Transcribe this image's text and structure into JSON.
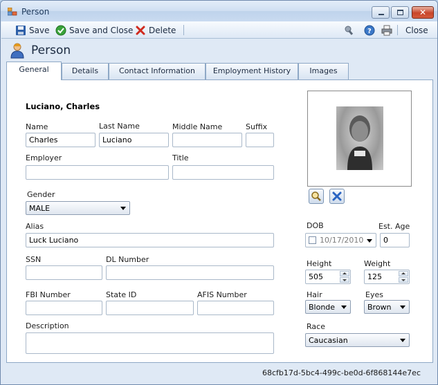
{
  "window": {
    "title": "Person",
    "colors": {
      "accent": "#1e395b",
      "frame": "#dfe9f5",
      "close": "#c8452a"
    }
  },
  "toolbar": {
    "save_label": "Save",
    "save_close_label": "Save and Close",
    "delete_label": "Delete",
    "close_label": "Close",
    "icons": [
      "save-icon",
      "save-close-icon",
      "delete-icon",
      "tools-icon",
      "help-icon",
      "print-icon"
    ]
  },
  "header": {
    "title": "Person"
  },
  "tabs": [
    {
      "label": "General",
      "active": true
    },
    {
      "label": "Details"
    },
    {
      "label": "Contact Information"
    },
    {
      "label": "Employment History"
    },
    {
      "label": "Images"
    }
  ],
  "general": {
    "display_name": "Luciano, Charles",
    "name_label": "Name",
    "name_value": "Charles",
    "last_name_label": "Last Name",
    "last_name_value": "Luciano",
    "middle_name_label": "Middle Name",
    "middle_name_value": "",
    "suffix_label": "Suffix",
    "suffix_value": "",
    "employer_label": "Employer",
    "employer_value": "",
    "title_label": "Title",
    "title_value": "",
    "gender_label": "Gender",
    "gender_value": "MALE",
    "alias_label": "Alias",
    "alias_value": "Luck Luciano",
    "ssn_label": "SSN",
    "ssn_value": "",
    "dl_number_label": "DL Number",
    "dl_number_value": "",
    "fbi_number_label": "FBI Number",
    "fbi_number_value": "",
    "state_id_label": "State ID",
    "state_id_value": "",
    "afis_number_label": "AFIS Number",
    "afis_number_value": "",
    "description_label": "Description",
    "description_value": "",
    "dob_label": "DOB",
    "dob_value": "10/17/2010",
    "est_age_label": "Est. Age",
    "est_age_value": "0",
    "height_label": "Height",
    "height_value": "505",
    "weight_label": "Weight",
    "weight_value": "125",
    "hair_label": "Hair",
    "hair_value": "Blonde",
    "eyes_label": "Eyes",
    "eyes_value": "Brown",
    "race_label": "Race",
    "race_value": "Caucasian"
  },
  "status": {
    "record_id": "68cfb17d-5bc4-499c-be0d-6f868144e7ec"
  }
}
